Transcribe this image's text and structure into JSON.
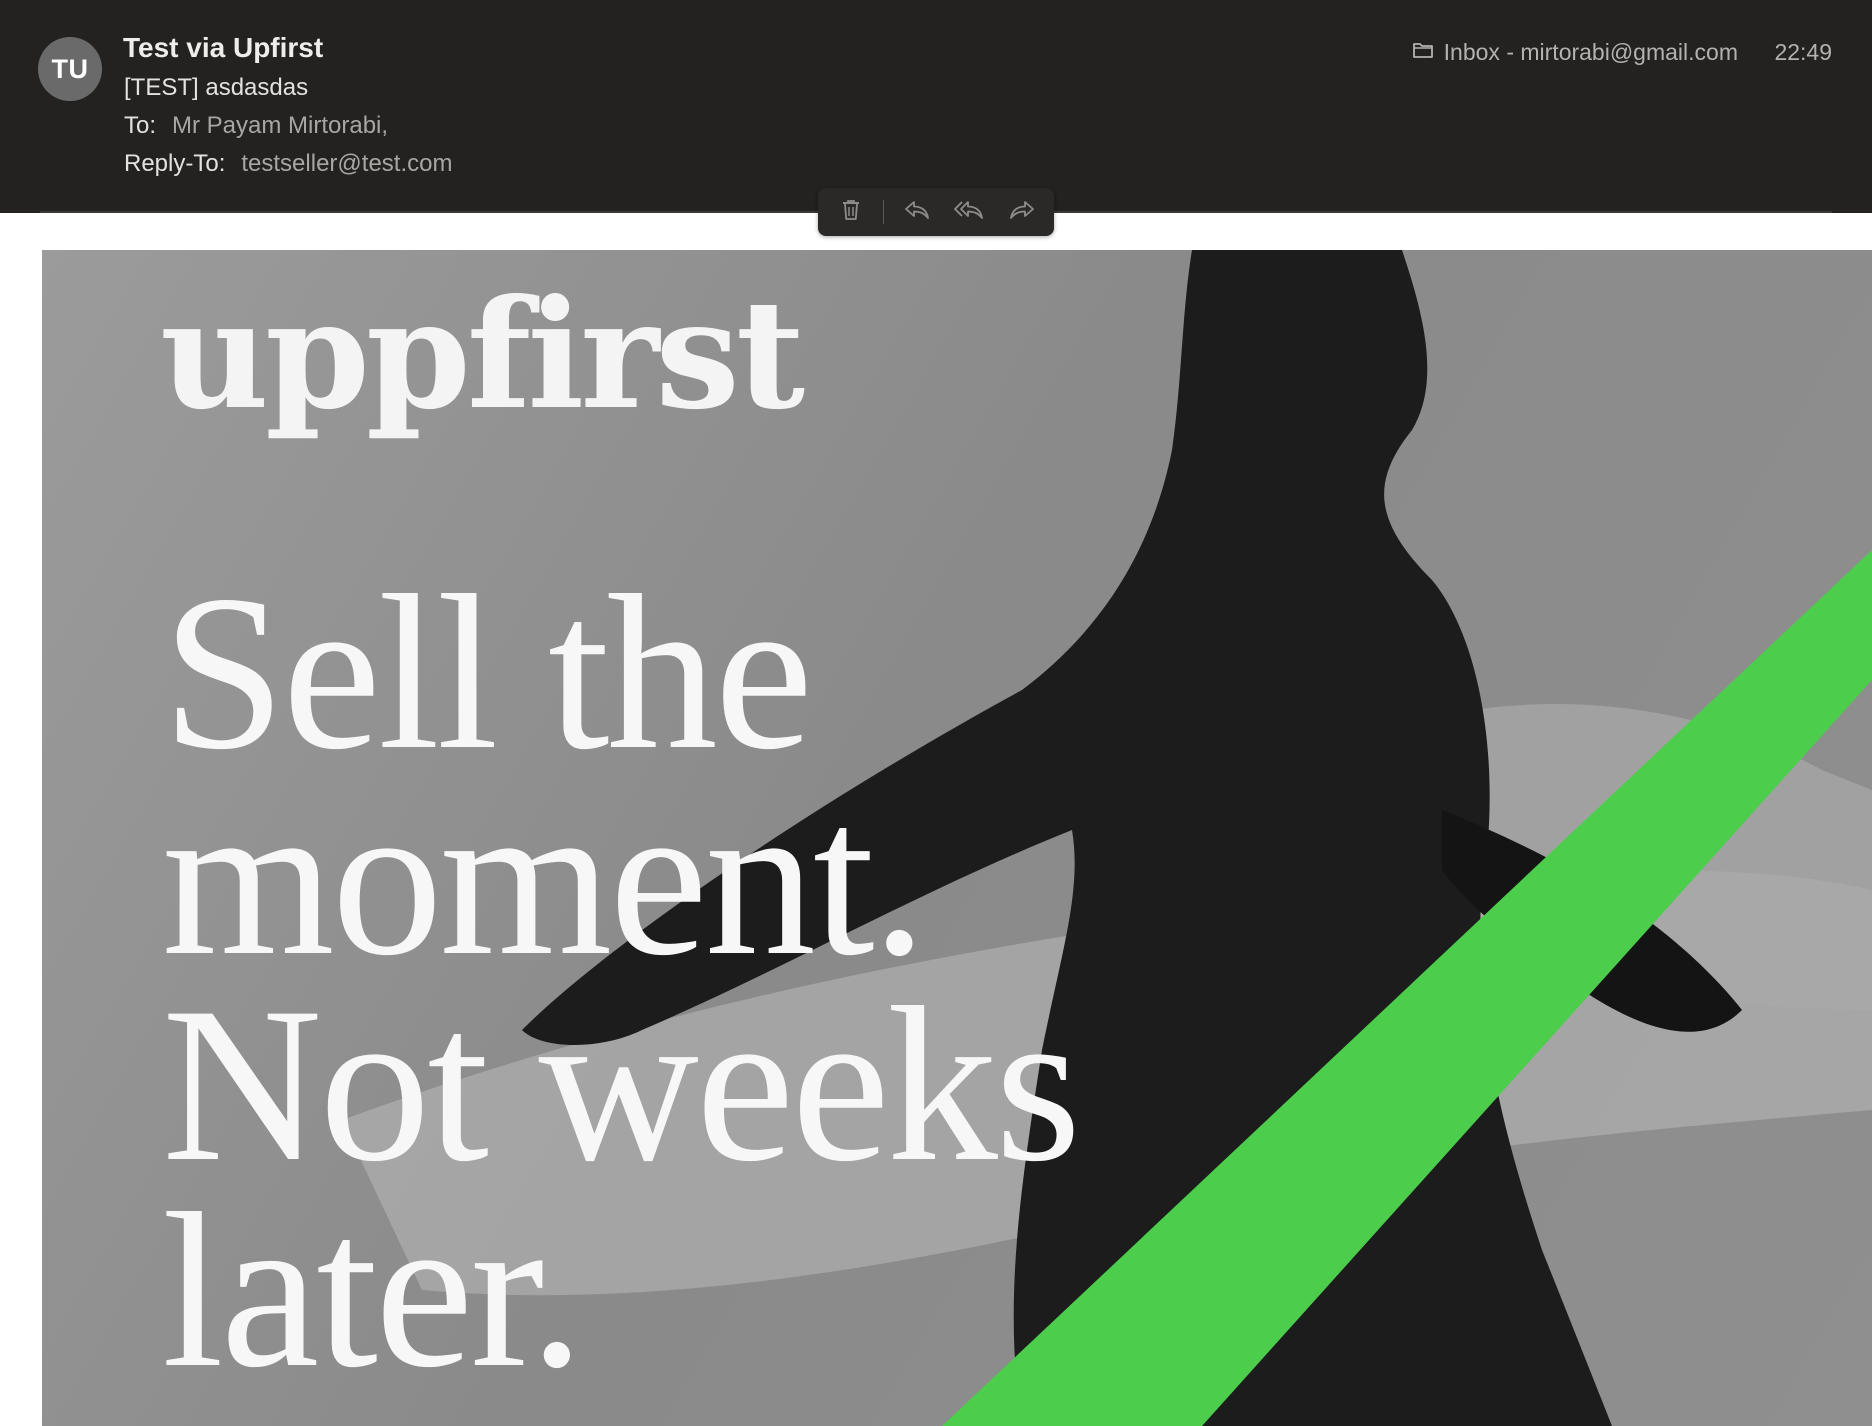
{
  "header": {
    "avatar_initials": "TU",
    "sender": "Test via Upfirst",
    "subject": "[TEST] asdasdas",
    "to_label": "To:",
    "to_value": "Mr Payam Mirtorabi,",
    "reply_to_label": "Reply-To:",
    "reply_to_value": "testseller@test.com",
    "mailbox": "Inbox - mirtorabi@gmail.com",
    "time": "22:49"
  },
  "toolbar": {
    "icons": [
      "trash-icon",
      "reply-icon",
      "reply-all-icon",
      "forward-icon"
    ]
  },
  "body": {
    "logo": "uppfirst",
    "headline": [
      "Sell the",
      "moment.",
      "Not weeks",
      "later."
    ],
    "accent_color": "#4ccd4c"
  }
}
